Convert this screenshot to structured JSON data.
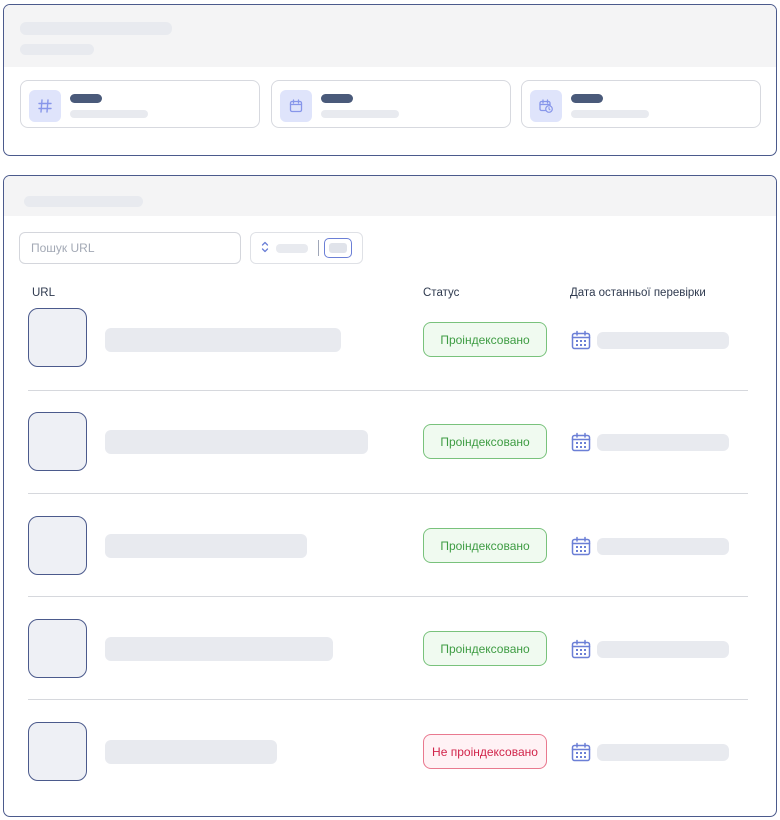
{
  "search": {
    "placeholder": "Пошук URL"
  },
  "table": {
    "columns": {
      "url": "URL",
      "status": "Статус",
      "last_checked": "Дата останньої перевірки"
    },
    "rows": [
      {
        "status": "Проіндексовано",
        "state": "indexed"
      },
      {
        "status": "Проіндексовано",
        "state": "indexed"
      },
      {
        "status": "Проіндексовано",
        "state": "indexed"
      },
      {
        "status": "Проіндексовано",
        "state": "indexed"
      },
      {
        "status": "Не проіндексовано",
        "state": "not-indexed"
      }
    ]
  },
  "colors": {
    "accent": "#6b7fd6",
    "border": "#4b5a8c",
    "indexed": "#3e9c43",
    "not_indexed": "#d1244a",
    "skeleton": "#e8eaef"
  },
  "icons": {
    "stat_1": "hash-icon",
    "stat_2": "calendar-icon",
    "stat_3": "calendar-clock-icon",
    "row_date": "calendar-icon"
  }
}
